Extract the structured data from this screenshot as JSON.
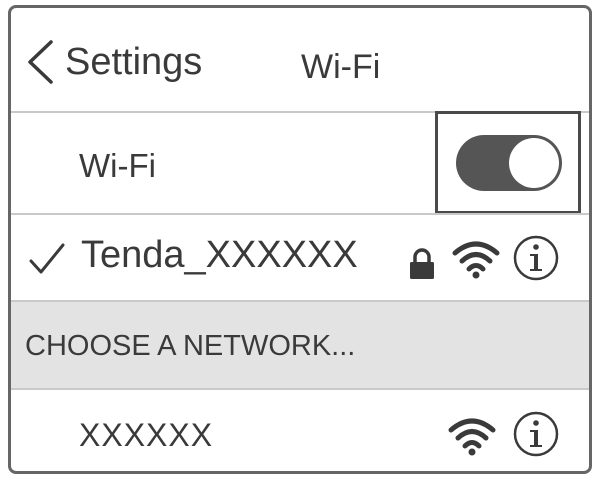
{
  "header": {
    "back_label": "Settings",
    "title": "Wi-Fi"
  },
  "wifi_toggle": {
    "label": "Wi-Fi",
    "state": "on"
  },
  "connected_network": {
    "name": "Tenda_XXXXXX",
    "icons": [
      "checkmark-icon",
      "lock-icon",
      "wifi-signal-icon",
      "info-icon"
    ]
  },
  "section": {
    "label": "CHOOSE A NETWORK..."
  },
  "networks": [
    {
      "name": "XXXXXX",
      "icons": [
        "wifi-signal-icon",
        "info-icon"
      ]
    }
  ],
  "colors": {
    "frame_border": "#666666",
    "text": "#3a3a3a",
    "toggle_on": "#555555",
    "section_bg": "#e3e3e3",
    "separator": "#c9c9c9"
  }
}
